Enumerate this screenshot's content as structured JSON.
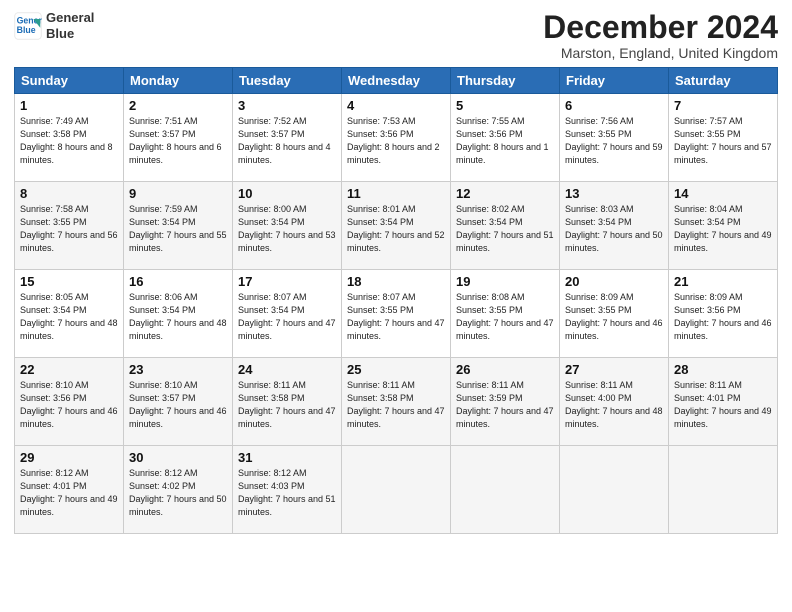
{
  "header": {
    "logo_line1": "General",
    "logo_line2": "Blue",
    "month_title": "December 2024",
    "location": "Marston, England, United Kingdom"
  },
  "days_of_week": [
    "Sunday",
    "Monday",
    "Tuesday",
    "Wednesday",
    "Thursday",
    "Friday",
    "Saturday"
  ],
  "weeks": [
    [
      {
        "day": "1",
        "sunrise": "Sunrise: 7:49 AM",
        "sunset": "Sunset: 3:58 PM",
        "daylight": "Daylight: 8 hours and 8 minutes."
      },
      {
        "day": "2",
        "sunrise": "Sunrise: 7:51 AM",
        "sunset": "Sunset: 3:57 PM",
        "daylight": "Daylight: 8 hours and 6 minutes."
      },
      {
        "day": "3",
        "sunrise": "Sunrise: 7:52 AM",
        "sunset": "Sunset: 3:57 PM",
        "daylight": "Daylight: 8 hours and 4 minutes."
      },
      {
        "day": "4",
        "sunrise": "Sunrise: 7:53 AM",
        "sunset": "Sunset: 3:56 PM",
        "daylight": "Daylight: 8 hours and 2 minutes."
      },
      {
        "day": "5",
        "sunrise": "Sunrise: 7:55 AM",
        "sunset": "Sunset: 3:56 PM",
        "daylight": "Daylight: 8 hours and 1 minute."
      },
      {
        "day": "6",
        "sunrise": "Sunrise: 7:56 AM",
        "sunset": "Sunset: 3:55 PM",
        "daylight": "Daylight: 7 hours and 59 minutes."
      },
      {
        "day": "7",
        "sunrise": "Sunrise: 7:57 AM",
        "sunset": "Sunset: 3:55 PM",
        "daylight": "Daylight: 7 hours and 57 minutes."
      }
    ],
    [
      {
        "day": "8",
        "sunrise": "Sunrise: 7:58 AM",
        "sunset": "Sunset: 3:55 PM",
        "daylight": "Daylight: 7 hours and 56 minutes."
      },
      {
        "day": "9",
        "sunrise": "Sunrise: 7:59 AM",
        "sunset": "Sunset: 3:54 PM",
        "daylight": "Daylight: 7 hours and 55 minutes."
      },
      {
        "day": "10",
        "sunrise": "Sunrise: 8:00 AM",
        "sunset": "Sunset: 3:54 PM",
        "daylight": "Daylight: 7 hours and 53 minutes."
      },
      {
        "day": "11",
        "sunrise": "Sunrise: 8:01 AM",
        "sunset": "Sunset: 3:54 PM",
        "daylight": "Daylight: 7 hours and 52 minutes."
      },
      {
        "day": "12",
        "sunrise": "Sunrise: 8:02 AM",
        "sunset": "Sunset: 3:54 PM",
        "daylight": "Daylight: 7 hours and 51 minutes."
      },
      {
        "day": "13",
        "sunrise": "Sunrise: 8:03 AM",
        "sunset": "Sunset: 3:54 PM",
        "daylight": "Daylight: 7 hours and 50 minutes."
      },
      {
        "day": "14",
        "sunrise": "Sunrise: 8:04 AM",
        "sunset": "Sunset: 3:54 PM",
        "daylight": "Daylight: 7 hours and 49 minutes."
      }
    ],
    [
      {
        "day": "15",
        "sunrise": "Sunrise: 8:05 AM",
        "sunset": "Sunset: 3:54 PM",
        "daylight": "Daylight: 7 hours and 48 minutes."
      },
      {
        "day": "16",
        "sunrise": "Sunrise: 8:06 AM",
        "sunset": "Sunset: 3:54 PM",
        "daylight": "Daylight: 7 hours and 48 minutes."
      },
      {
        "day": "17",
        "sunrise": "Sunrise: 8:07 AM",
        "sunset": "Sunset: 3:54 PM",
        "daylight": "Daylight: 7 hours and 47 minutes."
      },
      {
        "day": "18",
        "sunrise": "Sunrise: 8:07 AM",
        "sunset": "Sunset: 3:55 PM",
        "daylight": "Daylight: 7 hours and 47 minutes."
      },
      {
        "day": "19",
        "sunrise": "Sunrise: 8:08 AM",
        "sunset": "Sunset: 3:55 PM",
        "daylight": "Daylight: 7 hours and 47 minutes."
      },
      {
        "day": "20",
        "sunrise": "Sunrise: 8:09 AM",
        "sunset": "Sunset: 3:55 PM",
        "daylight": "Daylight: 7 hours and 46 minutes."
      },
      {
        "day": "21",
        "sunrise": "Sunrise: 8:09 AM",
        "sunset": "Sunset: 3:56 PM",
        "daylight": "Daylight: 7 hours and 46 minutes."
      }
    ],
    [
      {
        "day": "22",
        "sunrise": "Sunrise: 8:10 AM",
        "sunset": "Sunset: 3:56 PM",
        "daylight": "Daylight: 7 hours and 46 minutes."
      },
      {
        "day": "23",
        "sunrise": "Sunrise: 8:10 AM",
        "sunset": "Sunset: 3:57 PM",
        "daylight": "Daylight: 7 hours and 46 minutes."
      },
      {
        "day": "24",
        "sunrise": "Sunrise: 8:11 AM",
        "sunset": "Sunset: 3:58 PM",
        "daylight": "Daylight: 7 hours and 47 minutes."
      },
      {
        "day": "25",
        "sunrise": "Sunrise: 8:11 AM",
        "sunset": "Sunset: 3:58 PM",
        "daylight": "Daylight: 7 hours and 47 minutes."
      },
      {
        "day": "26",
        "sunrise": "Sunrise: 8:11 AM",
        "sunset": "Sunset: 3:59 PM",
        "daylight": "Daylight: 7 hours and 47 minutes."
      },
      {
        "day": "27",
        "sunrise": "Sunrise: 8:11 AM",
        "sunset": "Sunset: 4:00 PM",
        "daylight": "Daylight: 7 hours and 48 minutes."
      },
      {
        "day": "28",
        "sunrise": "Sunrise: 8:11 AM",
        "sunset": "Sunset: 4:01 PM",
        "daylight": "Daylight: 7 hours and 49 minutes."
      }
    ],
    [
      {
        "day": "29",
        "sunrise": "Sunrise: 8:12 AM",
        "sunset": "Sunset: 4:01 PM",
        "daylight": "Daylight: 7 hours and 49 minutes."
      },
      {
        "day": "30",
        "sunrise": "Sunrise: 8:12 AM",
        "sunset": "Sunset: 4:02 PM",
        "daylight": "Daylight: 7 hours and 50 minutes."
      },
      {
        "day": "31",
        "sunrise": "Sunrise: 8:12 AM",
        "sunset": "Sunset: 4:03 PM",
        "daylight": "Daylight: 7 hours and 51 minutes."
      },
      null,
      null,
      null,
      null
    ]
  ]
}
